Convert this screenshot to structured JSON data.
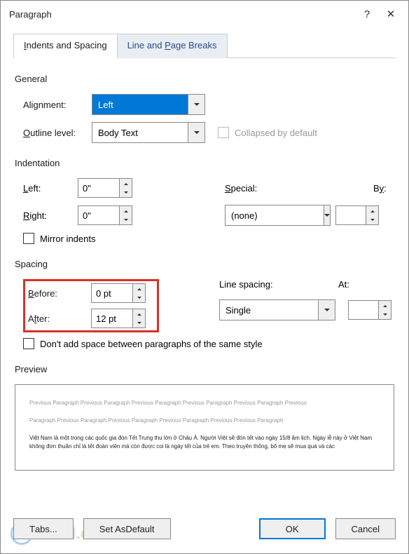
{
  "titlebar": {
    "title": "Paragraph"
  },
  "tabs": {
    "tab1": "Indents and Spacing",
    "tab2": "Line and Page Breaks"
  },
  "general": {
    "heading": "General",
    "alignment_label": "Alignment:",
    "alignment_value": "Left",
    "outline_label": "Outline level:",
    "outline_value": "Body Text",
    "collapsed_label": "Collapsed by default"
  },
  "indentation": {
    "heading": "Indentation",
    "left_label": "Left:",
    "left_value": "0\"",
    "right_label": "Right:",
    "right_value": "0\"",
    "special_label": "Special:",
    "special_value": "(none)",
    "by_label": "By:",
    "by_value": "",
    "mirror_label": "Mirror indents"
  },
  "spacing": {
    "heading": "Spacing",
    "before_label": "Before:",
    "before_value": "0 pt",
    "after_label": "After:",
    "after_value": "12 pt",
    "line_label": "Line spacing:",
    "line_value": "Single",
    "at_label": "At:",
    "at_value": "",
    "dont_add_label": "Don't add space between paragraphs of the same style"
  },
  "preview": {
    "heading": "Preview",
    "p1": "Previous Paragraph Previous Paragraph Previous Paragraph Previous Paragraph Previous Paragraph Previous",
    "p2": "Paragraph Previous Paragraph Previous Paragraph Previous Paragraph Previous Previous Paragraph",
    "p3": "Việt Nam là một trong các quốc gia đón Tết Trung thu lớn ở Châu Á. Người Việt sẽ đón tết vào ngày 15/8 âm lịch. Ngày lễ này ở Việt Nam không đơn thuần chỉ là tết đoàn viên mà còn được coi là ngày tết của trẻ em. Theo truyền thống, bố mẹ sẽ mua quà và các"
  },
  "buttons": {
    "tabs": "Tabs...",
    "default": "Set As Default",
    "ok": "OK",
    "cancel": "Cancel"
  },
  "watermark": {
    "word": "Word",
    "domain": ".com.vn"
  }
}
